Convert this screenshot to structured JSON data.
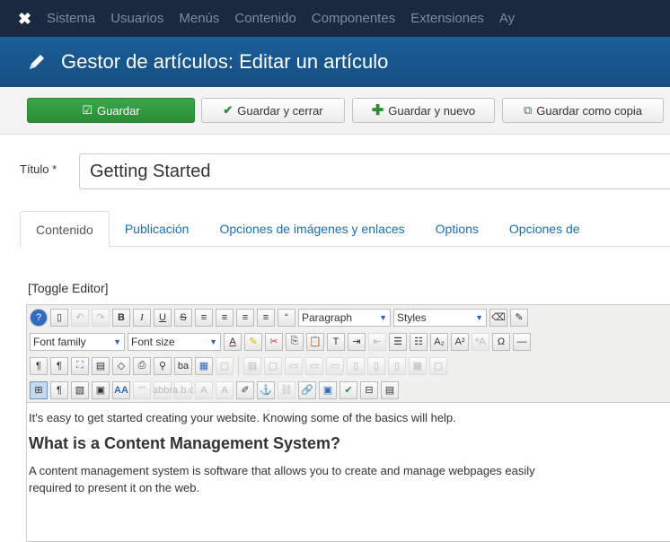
{
  "topnav": {
    "items": [
      "Sistema",
      "Usuarios",
      "Menús",
      "Contenido",
      "Componentes",
      "Extensiones",
      "Ay"
    ]
  },
  "header": {
    "title": "Gestor de artículos: Editar un artículo"
  },
  "toolbar": {
    "save_label": "Guardar",
    "save_close_label": "Guardar y cerrar",
    "save_new_label": "Guardar y nuevo",
    "save_copy_label": "Guardar como copia"
  },
  "form": {
    "title_label": "Título *",
    "title_value": "Getting Started"
  },
  "tabs": [
    "Contenido",
    "Publicación",
    "Opciones de imágenes y enlaces",
    "Options",
    "Opciones de"
  ],
  "editor": {
    "toggle_label": "[Toggle Editor]",
    "format_select": "Paragraph",
    "styles_select": "Styles",
    "font_family_select": "Font family",
    "font_size_select": "Font size",
    "paragraph1": "It's easy to get started creating your website. Knowing some of the basics will help.",
    "heading": "What is a Content Management System?",
    "paragraph2_line1": "A content management system is software that allows you to create and manage webpages easily",
    "paragraph2_line2": "required to present it on the web."
  },
  "colors": {
    "topnav_bg": "#1a2840",
    "header_bg": "#1b5f99",
    "save_green": "#2f9a3d",
    "link_blue": "#1a6fb5"
  }
}
